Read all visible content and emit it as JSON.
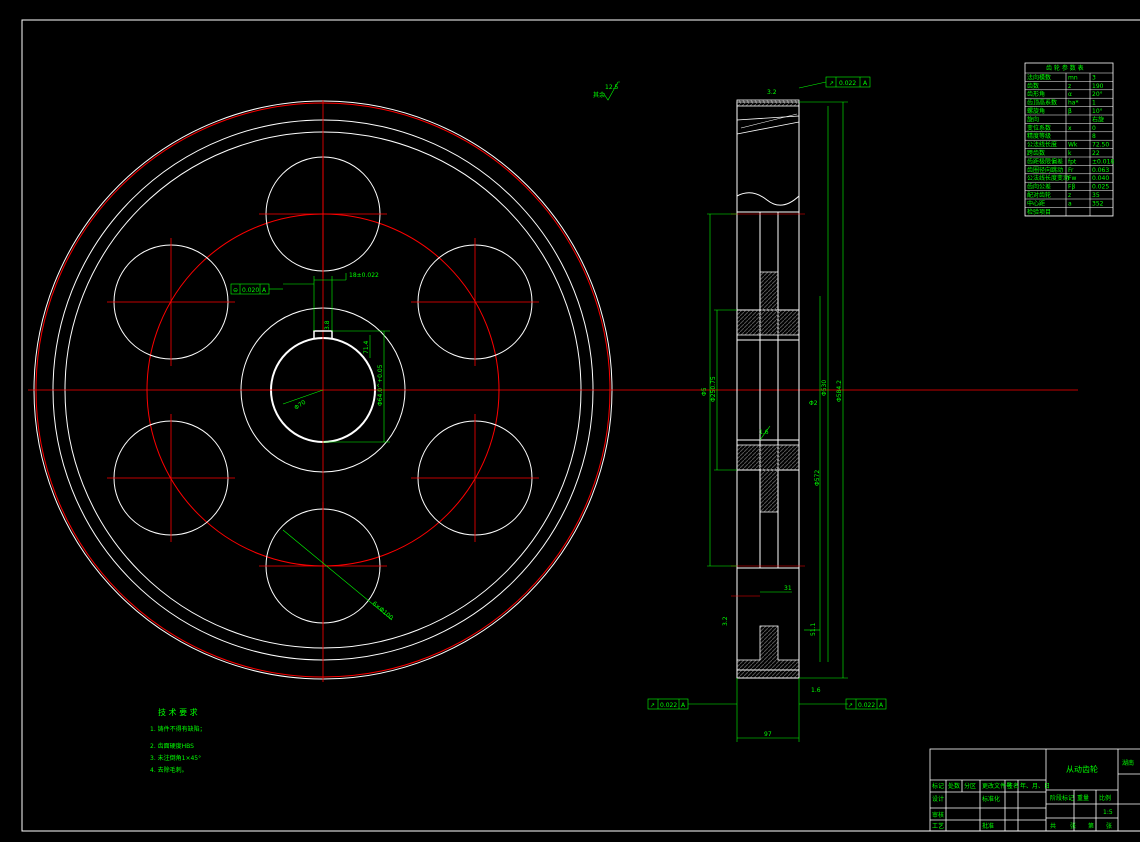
{
  "drawing": {
    "colors": {
      "background": "#000000",
      "outline": "#ffffff",
      "center_line": "#ff0000",
      "dimension": "#00ff00",
      "hatch": "#3a3a3a"
    }
  },
  "front_view": {
    "dims": {
      "keyway_width": "18±0.022",
      "keyway_depth": "3.8",
      "keyway_height": "71.4",
      "bore_height": "Φ64.0^+0.05",
      "bore_dia": "Φ70",
      "hole_dia": "6×Φ100",
      "runout": "0.020"
    },
    "roughness": {
      "top": "12.5",
      "top_note": "其余"
    }
  },
  "side_view": {
    "dims": {
      "width": "97",
      "d1": "Φ5",
      "d2": "Φ250.75",
      "d3": "Φ530",
      "d4": "Φ1.2",
      "d5": "Φ2",
      "d6": "Φ572",
      "d7": "Φ584.2",
      "rough_tooth": "3.2",
      "rough_face": "1.6",
      "rough_bore": "1.6",
      "rough_low": "3.2",
      "rough_bottom": "1.6",
      "dim_31": "31",
      "dim_51": "51.1"
    },
    "tolerance": {
      "top": "0.022",
      "left": "0.022",
      "right": "0.022",
      "datum": "A"
    }
  },
  "tech_req": {
    "title": "技 术 要 求",
    "items": [
      "1. 铸件不得有缺陷；",
      "2. 齿面硬度HBS",
      "3. 未注倒角1×45°",
      "4. 去除毛刺。"
    ]
  },
  "params_table": {
    "title": "齿 轮 参 数 表",
    "rows": [
      [
        "法向模数",
        "mn",
        "3"
      ],
      [
        "齿数",
        "z",
        "190"
      ],
      [
        "齿形角",
        "α",
        "20°"
      ],
      [
        "齿顶高系数",
        "ha*",
        "1"
      ],
      [
        "螺旋角",
        "β",
        "10°"
      ],
      [
        "旋向",
        "",
        "右旋"
      ],
      [
        "变位系数",
        "x",
        "0"
      ],
      [
        "精度等级",
        "",
        "8"
      ],
      [
        "公法线长度",
        "Wk",
        "72.50"
      ],
      [
        "跨齿数",
        "k",
        "22"
      ],
      [
        "齿距极限偏差",
        "fpt",
        "±0.018"
      ],
      [
        "齿圈径向跳动",
        "Fr",
        "0.063"
      ],
      [
        "公法线长度变动",
        "Fw",
        "0.040"
      ],
      [
        "齿向公差",
        "Fβ",
        "0.025"
      ],
      [
        "配对齿轮",
        "z",
        "35"
      ],
      [
        "中心距",
        "a",
        "352"
      ],
      [
        "检验项目",
        "",
        ""
      ]
    ]
  },
  "title_block": {
    "part_name": "从动齿轮",
    "school": "湖南",
    "header_row": [
      "标记",
      "处数",
      "分区",
      "更改文件号",
      "签名",
      "年、月、日"
    ],
    "roles": [
      "设计",
      "审核",
      "工艺"
    ],
    "std": "标准化",
    "approve": "批准",
    "stage": "阶段标记",
    "weight": "重量",
    "scale_label": "比例",
    "scale": "1:5",
    "sheets": [
      "共",
      "张",
      "第",
      "张"
    ]
  }
}
